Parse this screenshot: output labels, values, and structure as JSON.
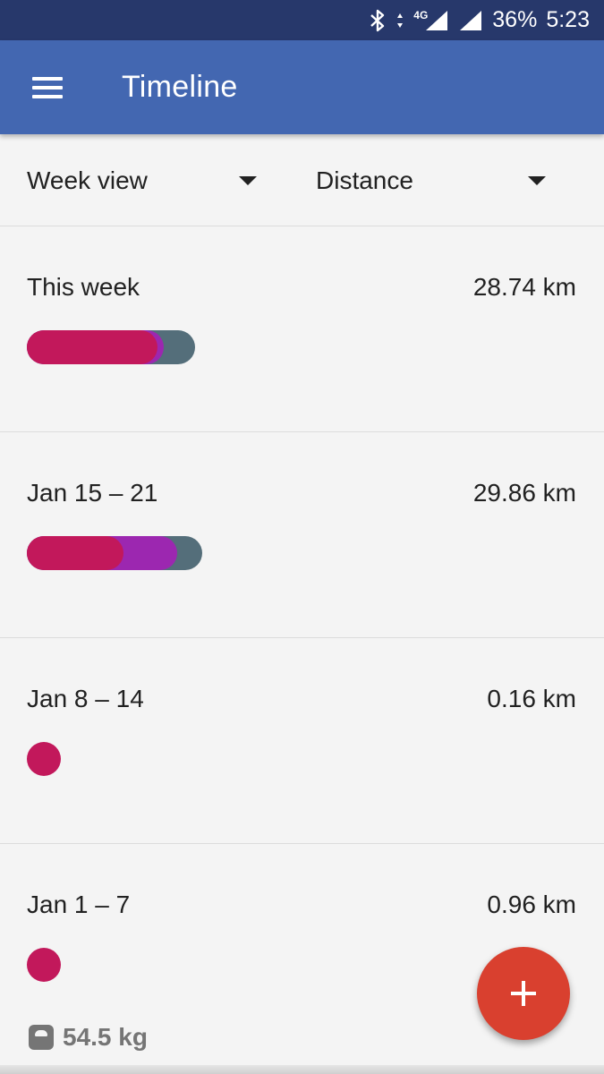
{
  "status_bar": {
    "network": "4G",
    "battery": "36%",
    "time": "5:23",
    "icons": [
      "bluetooth-icon",
      "data-arrows-icon",
      "signal-icon",
      "signal-icon"
    ]
  },
  "app_bar": {
    "title": "Timeline",
    "menu_icon": "hamburger-menu-icon",
    "color": "#4367b1"
  },
  "filters": {
    "view": {
      "selected": "Week view"
    },
    "metric": {
      "selected": "Distance"
    }
  },
  "colors": {
    "segment_primary": "#c2185b",
    "segment_secondary": "#9c27b0",
    "segment_track": "#546e7a",
    "fab": "#d9402f"
  },
  "weeks": [
    {
      "label": "This week",
      "distance": "28.74 km"
    },
    {
      "label": "Jan 15 – 21",
      "distance": "29.86 km"
    },
    {
      "label": "Jan 8 – 14",
      "distance": "0.16 km"
    },
    {
      "label": "Jan 1 – 7",
      "distance": "0.96 km",
      "weight": "54.5 kg"
    }
  ],
  "fab": {
    "icon": "plus-icon"
  }
}
